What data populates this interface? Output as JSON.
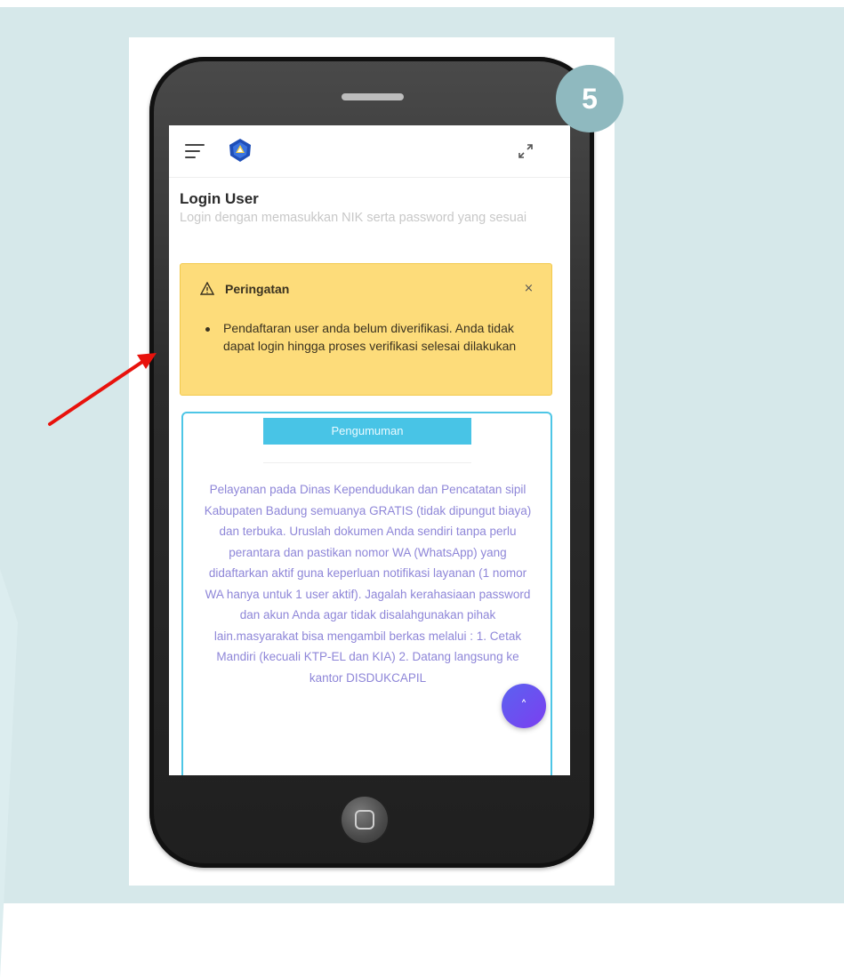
{
  "step_badge": "5",
  "colors": {
    "background": "#d6e8ea",
    "alert_bg": "#fddc7a",
    "announce_border": "#4ec6e6",
    "announce_text": "#8e86d8",
    "arrow": "#e8120c",
    "scroll_button": "#5b62f0"
  },
  "icons": {
    "menu": "hamburger-menu-icon",
    "logo": "badung-logo-icon",
    "expand": "expand-arrows-icon",
    "warning": "warning-triangle-icon",
    "close": "close-icon",
    "scroll_top": "chevron-up-icon",
    "home": "home-button-icon"
  },
  "login": {
    "title": "Login User",
    "subtitle": "Login dengan memasukkan NIK serta password yang sesuai"
  },
  "alert": {
    "title": "Peringatan",
    "close": "×",
    "message": "Pendaftaran user anda belum diverifikasi. Anda tidak dapat login hingga proses verifikasi selesai dilakukan"
  },
  "announcement": {
    "tab_label": "Pengumuman",
    "body": "Pelayanan pada Dinas Kependudukan dan Pencatatan sipil Kabupaten Badung semuanya GRATIS (tidak dipungut biaya) dan terbuka. Uruslah dokumen Anda sendiri tanpa perlu perantara dan pastikan nomor WA (WhatsApp) yang didaftarkan aktif guna keperluan notifikasi layanan (1 nomor WA hanya untuk 1 user aktif). Jagalah kerahasiaan password dan akun Anda agar tidak disalahgunakan pihak lain.masyarakat bisa mengambil berkas melalui : 1. Cetak Mandiri (kecuali KTP-EL dan KIA) 2. Datang langsung ke kantor DISDUKCAPIL"
  },
  "scroll_top_label": "˄"
}
